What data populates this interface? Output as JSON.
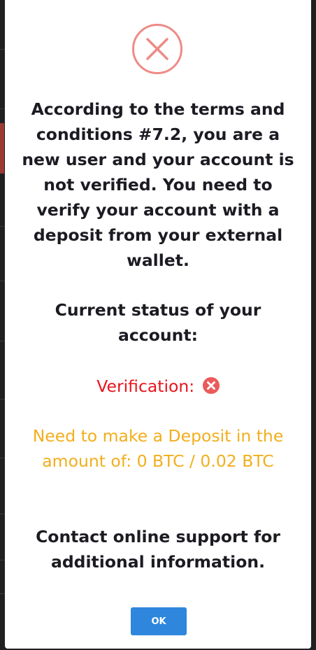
{
  "dialog": {
    "message": "According to the terms and conditions #7.2, you are a new user and your account is not verified. You need to verify your account with a deposit from your external wallet.",
    "status_heading": "Current status of your account:",
    "verification_label": "Verification:",
    "deposit_text": "Need to make a Deposit in the amount of: 0 BTC / 0.02 BTC",
    "contact_text": "Contact online support for additional information.",
    "ok_label": "OK"
  },
  "colors": {
    "error_icon": "#ee8b86",
    "verification": "#e8141c",
    "deposit": "#f2ae1c",
    "ok_button": "#2f86dd"
  }
}
